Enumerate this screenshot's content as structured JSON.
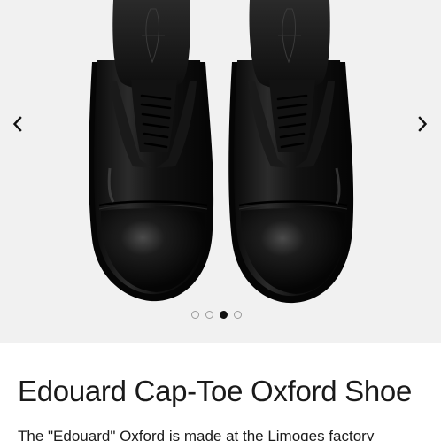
{
  "carousel": {
    "image_label": "Pair of black leather cap-toe oxford shoes, top view",
    "prev_icon": "chevron-left-icon",
    "next_icon": "chevron-right-icon",
    "slide_count": 4,
    "active_slide": 3
  },
  "product": {
    "title": "Edouard Cap-Toe Oxford Shoe",
    "description": "The \"Edouard\" Oxford is made at the Limoges factory"
  },
  "colors": {
    "page_background": "#ffffff",
    "image_background": "#f1f1f1",
    "text": "#1a1a1a",
    "active_dot": "#111111"
  }
}
